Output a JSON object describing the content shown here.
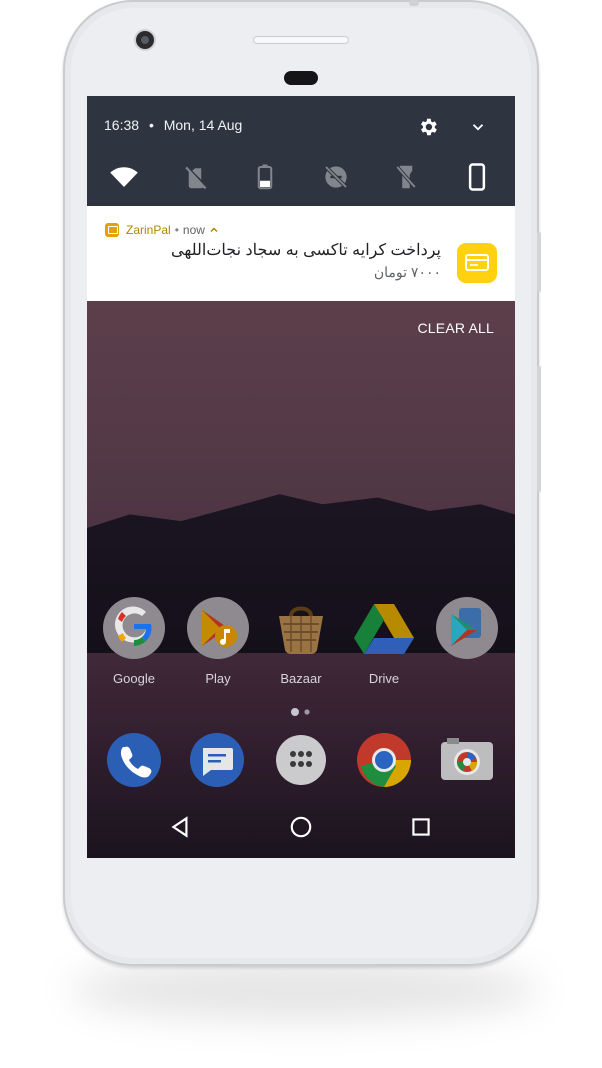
{
  "status_bar": {
    "time": "16:38",
    "date": "Mon, 14 Aug"
  },
  "quick_settings": {
    "icons": [
      "wifi-icon",
      "sim-off-icon",
      "battery-icon",
      "do-not-disturb-off-icon",
      "flashlight-off-icon",
      "phone-portrait-icon"
    ]
  },
  "notification": {
    "app_name": "ZarinPal",
    "separator": "•",
    "time": "now",
    "title": "پرداخت کرایه تاکسی به سجاد نجات‌اللهی",
    "body": "۷۰۰۰ تومان",
    "accent_color": "#ffd10f"
  },
  "clear_all_label": "CLEAR ALL",
  "home_apps": [
    {
      "label": "Google",
      "icon": "google-folder-icon"
    },
    {
      "label": "Play",
      "icon": "play-folder-icon"
    },
    {
      "label": "Bazaar",
      "icon": "bazaar-icon"
    },
    {
      "label": "Drive",
      "icon": "drive-icon"
    },
    {
      "label": "",
      "icon": "play-store-folder-icon"
    }
  ],
  "dock": [
    "phone-icon",
    "messages-icon",
    "app-drawer-icon",
    "chrome-icon",
    "camera-icon"
  ],
  "nav": [
    "back-icon",
    "home-icon",
    "recents-icon"
  ]
}
